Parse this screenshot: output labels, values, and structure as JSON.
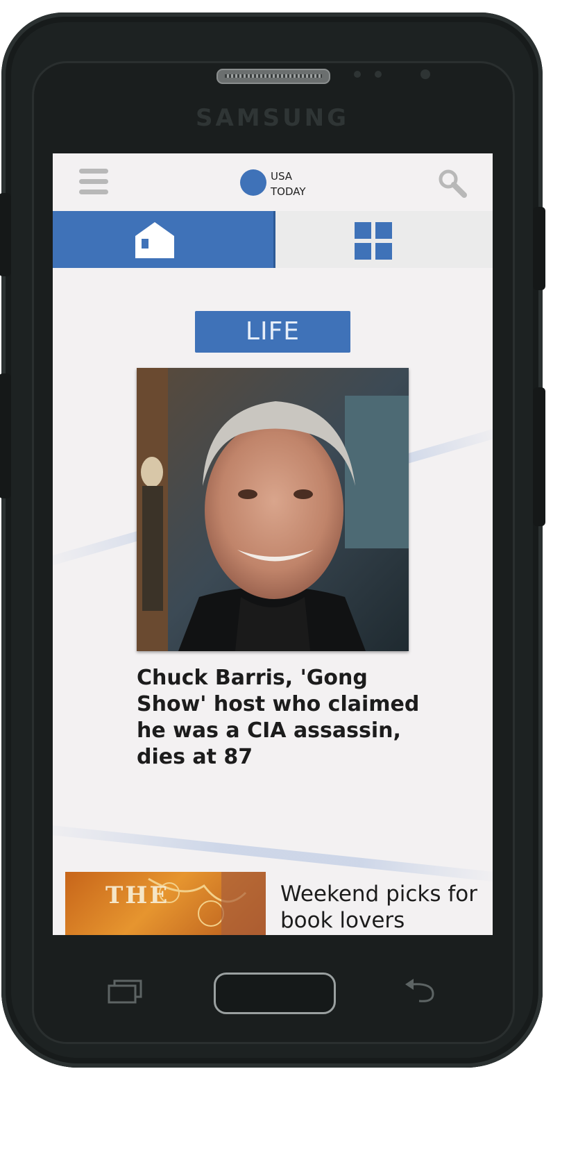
{
  "device": {
    "brand": "SAMSUNG"
  },
  "header": {
    "logo_line1": "USA",
    "logo_line2": "TODAY",
    "menu_icon": "hamburger-icon",
    "search_icon": "search-icon"
  },
  "tabs": [
    {
      "icon": "home-icon",
      "active": true
    },
    {
      "icon": "grid-icon",
      "active": false
    }
  ],
  "colors": {
    "accent": "#3f72b8",
    "background": "#f3f1f2",
    "headline": "#1c1c1c"
  },
  "feature": {
    "category": "LIFE",
    "headline": "Chuck Barris, 'Gong Show' host who claimed he was a CIA assassin, dies at 87"
  },
  "next_story": {
    "thumbnail_text": "THE",
    "headline": "Weekend picks for book lovers"
  },
  "nav_keys": [
    "recent-apps-key",
    "home-key",
    "back-key"
  ]
}
